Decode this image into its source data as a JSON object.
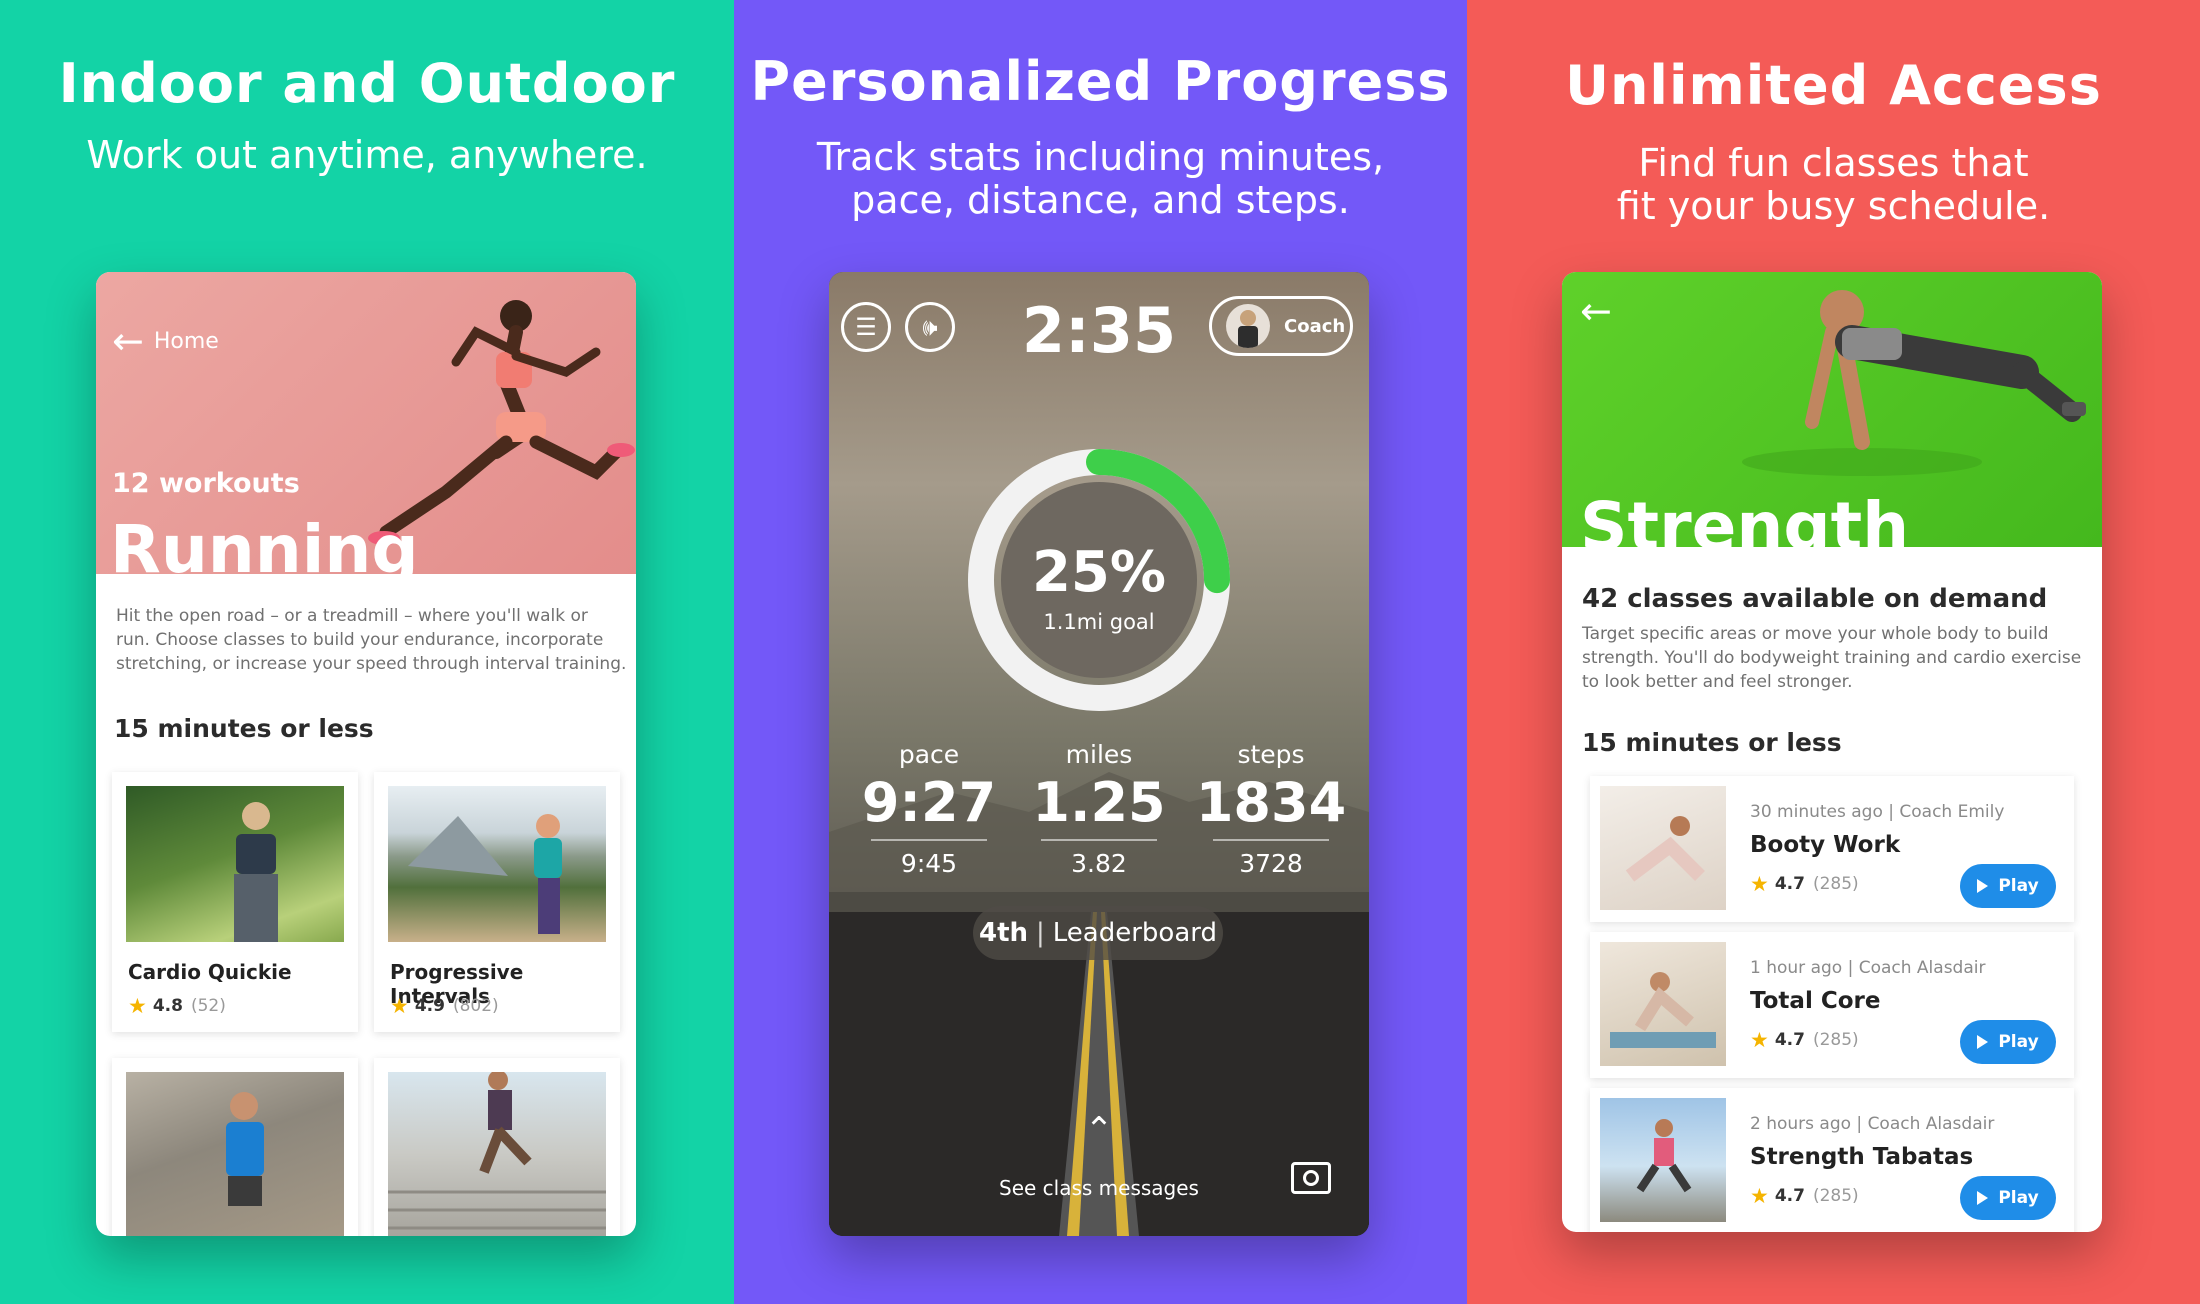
{
  "colors": {
    "panel1": "#13d3a6",
    "panel2": "#7358f8",
    "panel3": "#f45b57",
    "ring": "#3ecf4a",
    "play": "#1f8de8"
  },
  "panel1": {
    "title": "Indoor and Outdoor",
    "subtitle": "Work out anytime, anywhere.",
    "card": {
      "back_label": "Home",
      "count": "12 workouts",
      "category": "Running",
      "description": [
        "Hit the open road – or a treadmill – where you'll walk or",
        "run. Choose classes to build your endurance, incorporate",
        "stretching, or increase your speed through interval training."
      ],
      "section": "15 minutes or less",
      "workouts": [
        {
          "name": "Cardio Quickie",
          "rating": "4.8",
          "reviews": "(52)"
        },
        {
          "name": "Progressive Intervals",
          "rating": "4.9",
          "reviews": "(802)"
        }
      ]
    }
  },
  "panel2": {
    "title": "Personalized Progress",
    "subtitle_lines": [
      "Track stats including minutes,",
      "pace, distance, and steps."
    ],
    "card": {
      "timer": "2:35",
      "coach_label": "Coach",
      "progress_fraction": 0.25,
      "progress_pct": "25%",
      "goal": "1.1mi goal",
      "stats": [
        {
          "label": "pace",
          "value": "9:27",
          "sub": "9:45"
        },
        {
          "label": "miles",
          "value": "1.25",
          "sub": "3.82"
        },
        {
          "label": "steps",
          "value": "1834",
          "sub": "3728"
        }
      ],
      "rank": "4th",
      "leaderboard": "Leaderboard",
      "messages": "See class messages"
    }
  },
  "panel3": {
    "title": "Unlimited Access",
    "subtitle_lines": [
      "Find fun classes that",
      "fit your busy schedule."
    ],
    "card": {
      "category": "Strength",
      "available": "42 classes available on demand",
      "description": [
        "Target specific areas or move your whole body to build",
        "strength. You'll do bodyweight training and cardio exercise",
        "to look better and feel stronger."
      ],
      "section": "15 minutes or less",
      "play_label": "Play",
      "classes": [
        {
          "meta": "30 minutes ago | Coach Emily",
          "name": "Booty Work",
          "rating": "4.7",
          "reviews": "(285)"
        },
        {
          "meta": "1 hour ago | Coach Alasdair",
          "name": "Total Core",
          "rating": "4.7",
          "reviews": "(285)"
        },
        {
          "meta": "2 hours ago | Coach Alasdair",
          "name": "Strength Tabatas",
          "rating": "4.7",
          "reviews": "(285)"
        }
      ]
    }
  }
}
